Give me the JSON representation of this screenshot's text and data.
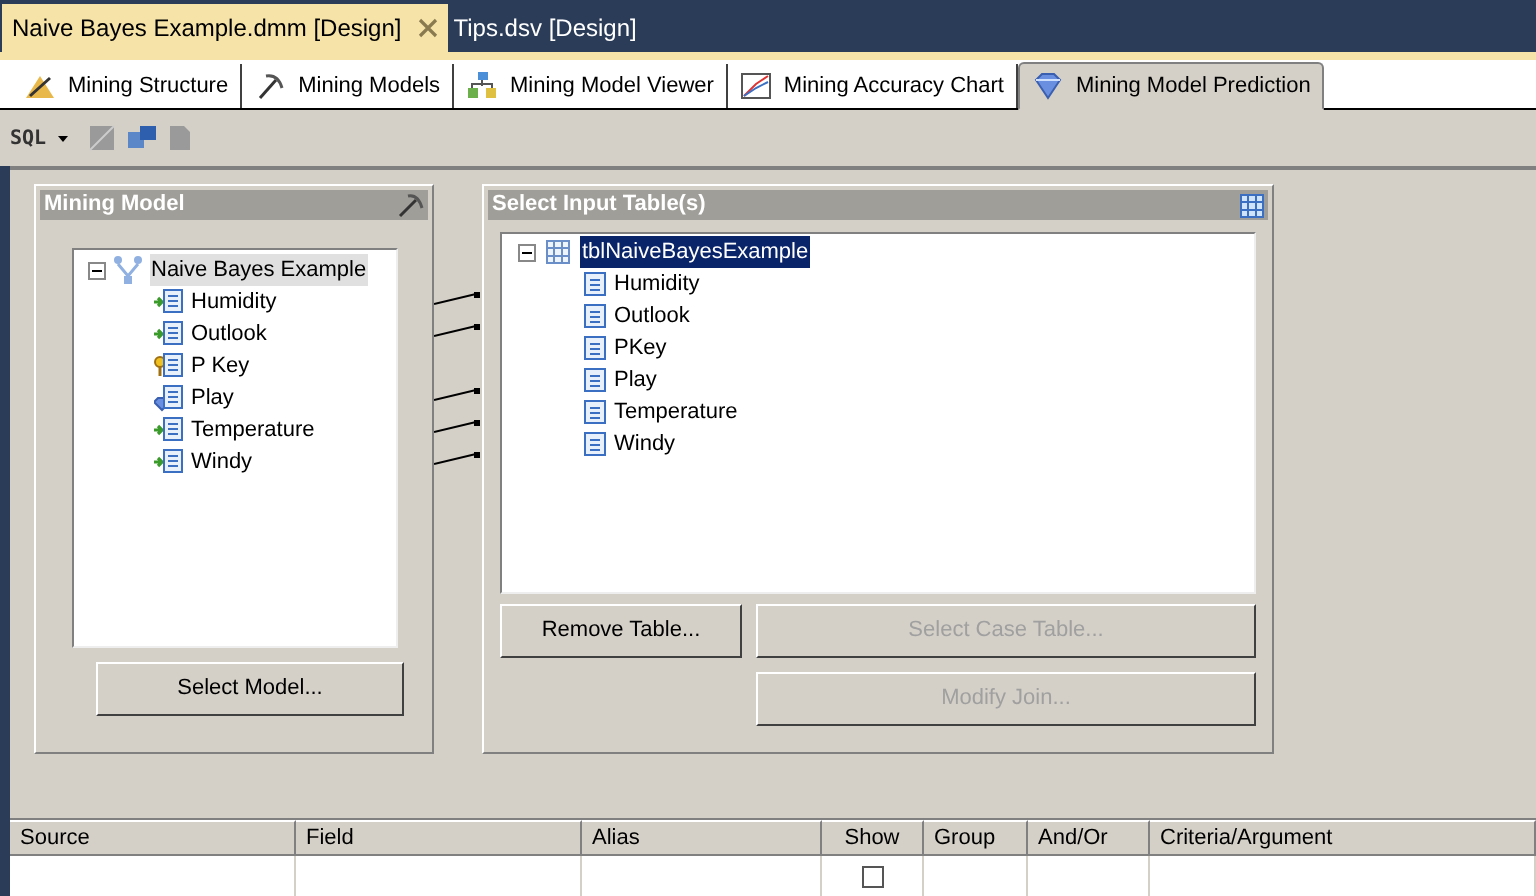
{
  "document_tabs": [
    {
      "label": "Naive Bayes Example.dmm [Design]",
      "selected": true
    },
    {
      "label": "Tips.dsv [Design]",
      "selected": false
    }
  ],
  "designer_tabs": [
    {
      "label": "Mining Structure",
      "kind": "structure",
      "selected": false
    },
    {
      "label": "Mining Models",
      "kind": "models",
      "selected": false
    },
    {
      "label": "Mining Model Viewer",
      "kind": "viewer",
      "selected": false
    },
    {
      "label": "Mining Accuracy Chart",
      "kind": "chart",
      "selected": false
    },
    {
      "label": "Mining Model Prediction",
      "kind": "prediction",
      "selected": true
    }
  ],
  "toolbar": {
    "sql_label": "SQL"
  },
  "mining_model": {
    "title": "Mining Model",
    "tree": {
      "label": "Naive Bayes Example",
      "selected": true,
      "expanded": true,
      "children": [
        {
          "label": "Humidity",
          "kind": "input"
        },
        {
          "label": "Outlook",
          "kind": "input"
        },
        {
          "label": "P Key",
          "kind": "key"
        },
        {
          "label": "Play",
          "kind": "predict"
        },
        {
          "label": "Temperature",
          "kind": "input"
        },
        {
          "label": "Windy",
          "kind": "input"
        }
      ]
    },
    "button": "Select Model..."
  },
  "input_tables": {
    "title": "Select Input Table(s)",
    "tree": {
      "label": "tblNaiveBayesExample",
      "selected": true,
      "expanded": true,
      "children": [
        {
          "label": "Humidity"
        },
        {
          "label": "Outlook"
        },
        {
          "label": "PKey"
        },
        {
          "label": "Play"
        },
        {
          "label": "Temperature"
        },
        {
          "label": "Windy"
        }
      ]
    },
    "buttons": [
      {
        "label": "Remove Table...",
        "disabled": false
      },
      {
        "label": "Select Case Table...",
        "disabled": true
      },
      {
        "label": "Modify Join...",
        "disabled": true
      }
    ]
  },
  "grid": {
    "columns": [
      "Source",
      "Field",
      "Alias",
      "Show",
      "Group",
      "And/Or",
      "Criteria/Argument"
    ],
    "rows": [
      {
        "show": false
      }
    ]
  }
}
